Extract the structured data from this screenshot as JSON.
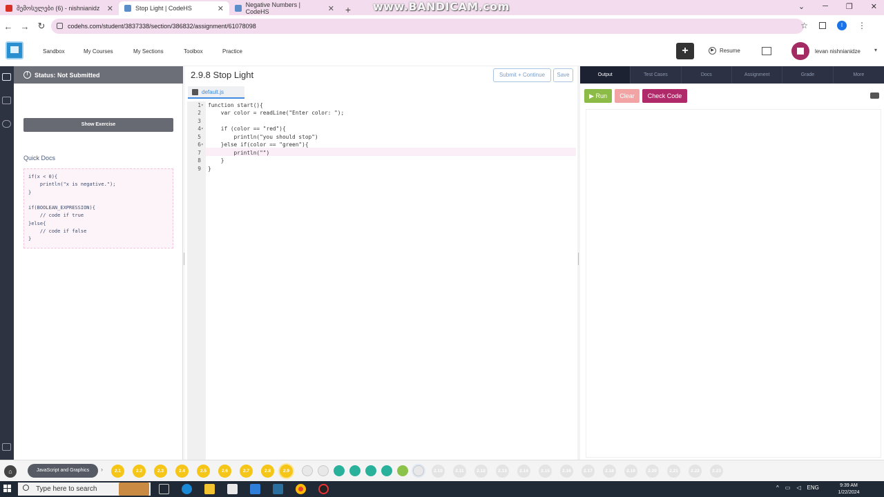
{
  "browser": {
    "tabs": [
      {
        "title": "შემოსულები (6) - nishnianidz",
        "icon_color": "#d93025"
      },
      {
        "title": "Stop Light | CodeHS",
        "icon_color": "#5b8ec9"
      },
      {
        "title": "Negative Numbers | CodeHS",
        "icon_color": "#5b8ec9"
      }
    ],
    "tab_close": "✕",
    "new_tab": "+",
    "watermark": "www.BANDICAM.com",
    "window_controls": [
      "⌄",
      "─",
      "❐",
      "✕"
    ],
    "nav": {
      "back": "←",
      "forward": "→",
      "reload": "↻"
    },
    "url": "codehs.com/student/3837338/section/386832/assignment/61078098",
    "star": "☆",
    "profile_initial": "l",
    "menu": "⋮"
  },
  "header": {
    "nav": [
      "Sandbox",
      "My Courses",
      "My Sections",
      "Toolbox",
      "Practice"
    ],
    "plus": "+",
    "resume": "Resume",
    "username": "levan nishnianidze",
    "caret": "▾"
  },
  "left_panel": {
    "status": "Status: Not Submitted",
    "show_exercise": "Show Exercise",
    "quick_docs_title": "Quick Docs",
    "quick_docs_code": "if(x < 0){\n    println(\"x is negative.\");\n}\n\nif(BOOLEAN_EXPRESSION){\n    // code if true\n}else{\n    // code if false\n}"
  },
  "editor": {
    "title": "2.9.8 Stop Light",
    "submit_label": "Submit + Continue",
    "save_label": "Save",
    "file_name": "default.js",
    "active_line": 7,
    "lines": [
      {
        "num": "1",
        "fold": "▾",
        "text": "function start(){"
      },
      {
        "num": "2",
        "fold": "",
        "text": "    var color = readLine(\"Enter color: \");"
      },
      {
        "num": "3",
        "fold": "",
        "text": ""
      },
      {
        "num": "4",
        "fold": "▾",
        "text": "    if (color == \"red\"){"
      },
      {
        "num": "5",
        "fold": "",
        "text": "        println(\"you should stop\")"
      },
      {
        "num": "6",
        "fold": "▾",
        "text": "    }else if(color == \"green\"){"
      },
      {
        "num": "7",
        "fold": "",
        "text": "        println(\"\")"
      },
      {
        "num": "8",
        "fold": "",
        "text": "    }"
      },
      {
        "num": "9",
        "fold": "",
        "text": "}"
      }
    ]
  },
  "right_panel": {
    "tabs": [
      "Output",
      "Test Cases",
      "Docs",
      "Assignment",
      "Grade",
      "More"
    ],
    "active_tab": "Output",
    "run_label": "▶ Run",
    "clear_label": "Clear",
    "check_code_label": "Check Code"
  },
  "course_bar": {
    "course_name": "JavaScript and Graphics",
    "arrow": "›",
    "completed": [
      "2.1",
      "2.2",
      "2.3",
      "2.4",
      "2.5",
      "2.6",
      "2.7",
      "2.8"
    ],
    "current": "2.9",
    "upcoming": [
      "2.10",
      "2.11",
      "2.12",
      "2.13",
      "2.14",
      "2.15",
      "2.16",
      "2.17",
      "2.18",
      "2.19",
      "2.20",
      "2.21",
      "2.22",
      "2.23"
    ],
    "colors": {
      "done": "#f5c518",
      "todo": "#e4e4e4"
    }
  },
  "taskbar": {
    "search_placeholder": "Type here to search",
    "language": "ENG",
    "time": "9:39 AM",
    "date": "1/22/2024",
    "tray_arrow": "^"
  }
}
